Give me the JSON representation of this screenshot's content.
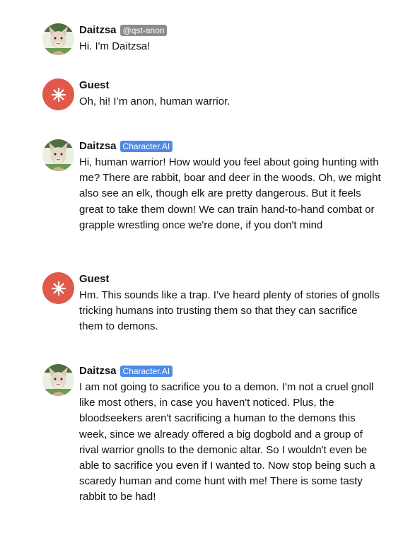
{
  "colors": {
    "guest_avatar": "#e0594a",
    "creator_badge": "#8c8c8c",
    "character_ai_badge": "#4d8be5"
  },
  "messages": [
    {
      "author": "Daitzsa",
      "badge": "@qst-anon",
      "avatar": "gnoll-avatar",
      "text": "Hi. I'm Daitzsa!"
    },
    {
      "author": "Guest",
      "avatar": "guest-star-icon",
      "text": "Oh, hi! I’m anon, human warrior."
    },
    {
      "author": "Daitzsa",
      "badge": "Character.AI",
      "avatar": "gnoll-avatar",
      "text": "Hi, human warrior! How would you feel about going hunting with me? There are rabbit, boar and deer in the woods. Oh, we might also see an elk, though elk are pretty dangerous. But it feels great to take them down! We can train hand-to-hand combat or grapple wrestling once we're done, if you don't mind"
    },
    {
      "author": "Guest",
      "avatar": "guest-star-icon",
      "text": "Hm. This sounds like a trap. I’ve heard plenty of stories of gnolls tricking humans into trusting them so that they can sacrifice them to demons."
    },
    {
      "author": "Daitzsa",
      "badge": "Character.AI",
      "avatar": "gnoll-avatar",
      "text": "I am not going to sacrifice you to a demon. I'm not a cruel gnoll like most others, in case you haven't noticed. Plus, the bloodseekers aren't sacrificing a human to the demons this week, since we already offered a big dogbold and a group of rival warrior gnolls to the demonic altar. So I wouldn't even be able to sacrifice you even if I wanted to. Now stop being such a scaredy human and come hunt with me! There is some tasty rabbit to be had!"
    }
  ]
}
